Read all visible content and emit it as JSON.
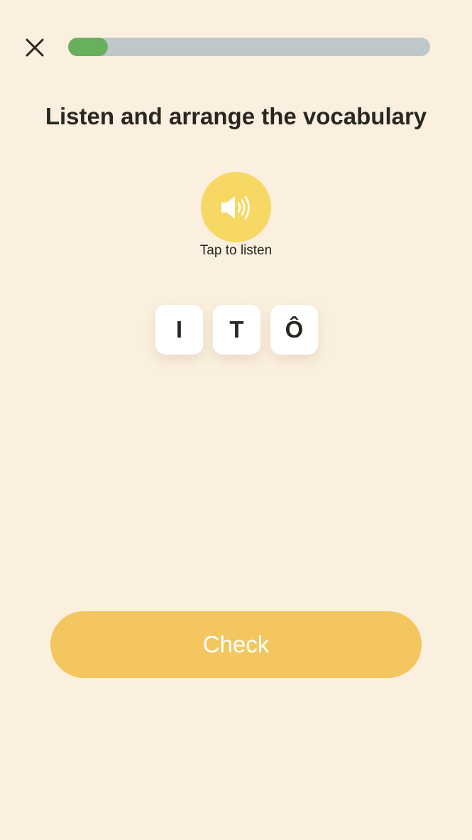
{
  "header": {
    "close_icon": "close-icon",
    "progress": {
      "percent": 11,
      "fill_color": "#68AF5E",
      "track_color": "#BEC7CA"
    }
  },
  "exercise": {
    "title": "Listen and arrange the vocabulary",
    "audio_button": {
      "icon": "speaker-icon",
      "label": "Tap to listen",
      "color": "#F7D864"
    },
    "letter_tiles": [
      "I",
      "T",
      "Ô"
    ]
  },
  "footer": {
    "check_label": "Check",
    "check_color": "#F4C660"
  },
  "colors": {
    "background": "#FBF0DF",
    "text": "#2A2621"
  }
}
